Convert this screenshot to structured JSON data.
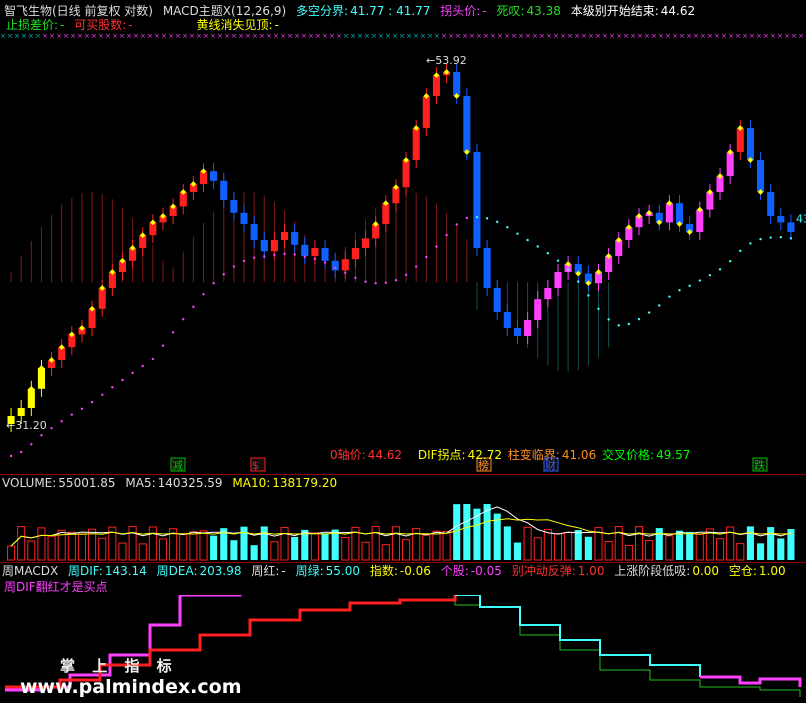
{
  "header": {
    "stock": "智飞生物(日线 前复权 对数)",
    "indicator": "MACD主题X(12,26,9)",
    "dkb_label": "多空分界:",
    "dkb_value": "41.77 : 41.77",
    "gt_label": "拐头价:",
    "gt_value": "-",
    "sy_label": "死叹:",
    "sy_value": "43.38",
    "bj_label": "本级别开始结束:",
    "bj_value": "44.62"
  },
  "header2": {
    "zs_label": "止损差价:",
    "zs_value": "-",
    "kmg_label": "可买股数:",
    "kmg_value": "-",
    "hj_label": "黄线消失见顶:",
    "hj_value": "-"
  },
  "price_panel": {
    "high_label": "53.92",
    "low_label": "31.20",
    "right_label": "43",
    "bottom_items": [
      {
        "label": "0轴价:",
        "value": "44.62",
        "color": "#ff3030"
      },
      {
        "label": "DIF拐点:",
        "value": "42.72",
        "color": "#ffff00"
      },
      {
        "label": "柱变临界:",
        "value": "41.06",
        "color": "#ff9020"
      },
      {
        "label": "交叉价格:",
        "value": "49.57",
        "color": "#00ff00"
      }
    ],
    "signals": [
      {
        "text": "减",
        "color": "#00c000"
      },
      {
        "text": "$",
        "color": "#ff2020"
      },
      {
        "text": "榜",
        "color": "#ff9020"
      },
      {
        "text": "财",
        "color": "#3060ff"
      },
      {
        "text": "跌",
        "color": "#00c000"
      }
    ]
  },
  "volume_panel": {
    "vol_label": "VOLUME:",
    "vol_value": "55001.85",
    "ma5_label": "MA5:",
    "ma5_value": "140325.59",
    "ma10_label": "MA10:",
    "ma10_value": "138179.20"
  },
  "macd_panel": {
    "title": "周MACDX",
    "dif_label": "周DIF:",
    "dif_value": "143.14",
    "dea_label": "周DEA:",
    "dea_value": "203.98",
    "hong_label": "周红:",
    "hong_value": "-",
    "lv_label": "周绿:",
    "lv_value": "55.00",
    "zs_label": "指数:",
    "zs_value": "-0.06",
    "gg_label": "个股:",
    "gg_value": "-0.05",
    "cz_label": "别冲动反弹:",
    "cz_value": "1.00",
    "sz_label": "上涨阶段低吸:",
    "sz_value": "0.00",
    "kc_label": "空仓:",
    "kc_value": "1.00",
    "note": "周DIF翻红才是买点"
  },
  "watermark": {
    "cn": "掌 上 指 标",
    "url": "www.palmindex.com"
  },
  "colors": {
    "up": "#ff2020",
    "down": "#1060ff",
    "magenta": "#ff40ff",
    "yellow": "#ffff00",
    "cyan": "#40ffff",
    "green": "#20c020"
  },
  "chart_data": {
    "type": "candlestick",
    "closes": [
      31.5,
      32.0,
      33.2,
      34.5,
      35.0,
      35.8,
      36.6,
      37.0,
      38.2,
      39.5,
      40.5,
      41.2,
      42.0,
      42.8,
      43.6,
      44.0,
      44.6,
      45.5,
      46.0,
      46.8,
      46.2,
      45.0,
      44.2,
      43.5,
      42.5,
      41.8,
      42.5,
      43.0,
      42.2,
      41.5,
      42.0,
      41.2,
      40.6,
      41.3,
      42.0,
      42.6,
      43.5,
      44.8,
      45.8,
      47.5,
      49.5,
      51.5,
      52.8,
      53.0,
      51.5,
      48.0,
      42.0,
      39.5,
      38.0,
      37.0,
      36.5,
      37.5,
      38.8,
      39.5,
      40.5,
      41.0,
      40.4,
      39.8,
      40.5,
      41.5,
      42.5,
      43.3,
      44.0,
      44.2,
      43.6,
      44.8,
      43.5,
      43.0,
      44.4,
      45.5,
      46.5,
      48.0,
      49.5,
      47.5,
      45.5,
      44.0,
      43.6,
      43.0
    ],
    "volume_ma": [
      "MA5",
      "MA10"
    ]
  }
}
